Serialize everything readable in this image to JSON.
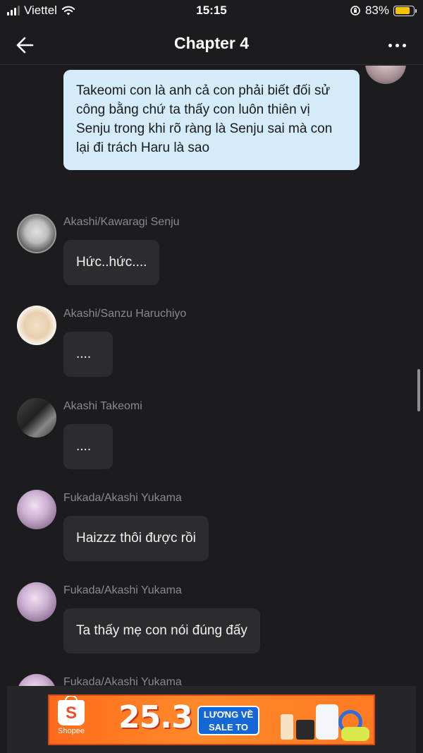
{
  "status_bar": {
    "carrier": "Viettel",
    "time": "15:15",
    "battery_percent": "83%",
    "battery_level": 0.83,
    "battery_color": "#f5c400"
  },
  "nav": {
    "title": "Chapter 4",
    "back_icon": "arrow-left-icon",
    "more_icon": "more-horizontal-icon"
  },
  "outgoing_message": {
    "text": "Takeomi con là anh cả con phải biết đối sử công bằng chứ ta thấy con luôn thiên vị Senju trong khi rõ ràng là Senju sai mà con lại đi trách Haru là sao",
    "bubble_color": "#d4ecfa"
  },
  "messages": [
    {
      "sender": "Akashi/Kawaragi Senju",
      "text": "Hức..hức...."
    },
    {
      "sender": "Akashi/Sanzu Haruchiyo",
      "text": "...."
    },
    {
      "sender": "Akashi Takeomi",
      "text": "...."
    },
    {
      "sender": "Fukada/Akashi Yukama",
      "text": "Haizzz thôi được rồi"
    },
    {
      "sender": "Fukada/Akashi Yukama",
      "text": "Ta thấy mẹ con nói đúng đấy"
    },
    {
      "sender": "Fukada/Akashi Yukama",
      "text": ""
    }
  ],
  "ad": {
    "brand": "Shopee",
    "logo_letter": "S",
    "date": "25.3",
    "badge_line1": "LƯƠNG VỀ",
    "badge_line2": "SALE TO",
    "accent_color": "#ff6a1a"
  }
}
